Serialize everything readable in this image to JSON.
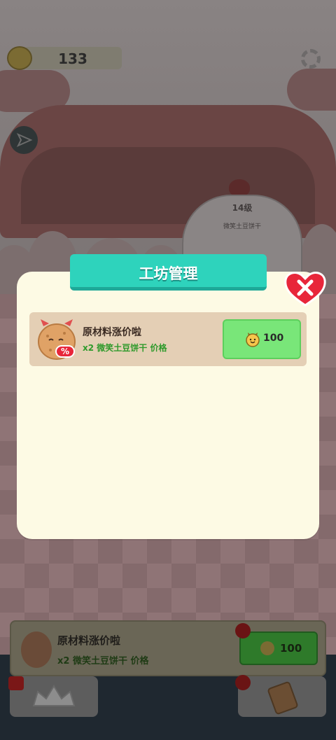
{
  "hud": {
    "coins": "133",
    "coin_icon": "smiley-coin-icon",
    "settings_icon": "gear-icon",
    "share_icon": "paper-plane-icon"
  },
  "background": {
    "machine_level": "14级",
    "machine_product": "微笑土豆饼干",
    "bottom_card": {
      "title": "原材料涨价啦",
      "subtitle": "x2 微笑土豆饼干 价格",
      "price": "100"
    },
    "nav": {
      "left_icon": "crown-icon",
      "right_icon": "tag-icon"
    }
  },
  "modal": {
    "title": "工坊管理",
    "close_icon": "heart-close-icon",
    "items": [
      {
        "icon": "percent-cookie-icon",
        "title": "原材料涨价啦",
        "subtitle": "x2 微笑土豆饼干 价格",
        "price": "100"
      }
    ]
  },
  "colors": {
    "header_teal": "#2ed3bc",
    "modal_bg": "#fdfae4",
    "item_bg": "#e4cfb5",
    "buy_green": "#79e679",
    "subtitle_green": "#2f9a2c",
    "close_red": "#e8263a"
  }
}
